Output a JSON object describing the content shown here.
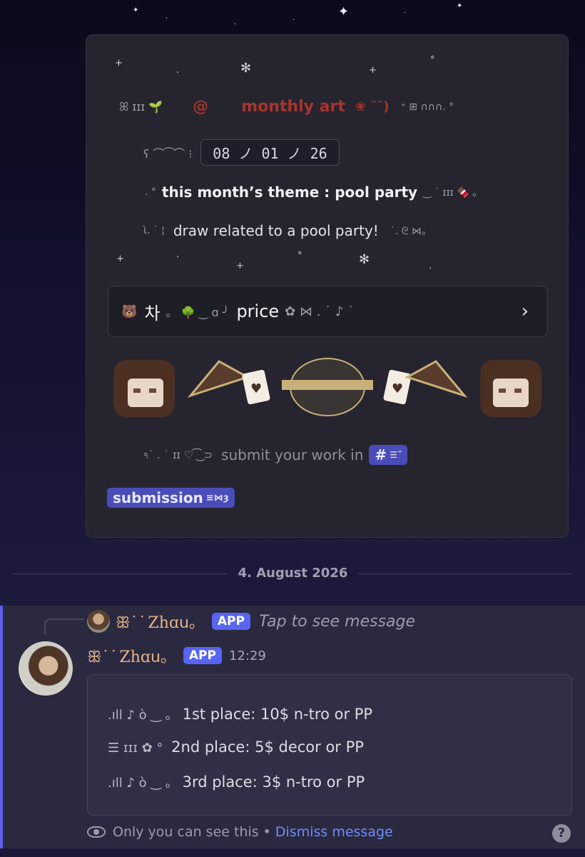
{
  "embed": {
    "title_prefix": "@",
    "title": "monthly art",
    "title_suffix": "❀ ˜˜)",
    "date": "08 ノ 01 ノ 26",
    "theme": "this month’s theme : pool party",
    "description": "draw related to a pool party!",
    "price_label": "price",
    "price_prefix": "차",
    "submit_text": "submit your work in",
    "channel_icon": "#",
    "channel_name": "submission"
  },
  "divider": {
    "date": "4. August 2026"
  },
  "message": {
    "reply": {
      "username": "ꕥ˙ ͘ Zhɑ𝗎。",
      "badge": "APP",
      "text": "Tap to see message"
    },
    "username": "ꕥ˙ ͘ Zhɑ𝗎。",
    "badge": "APP",
    "time": "12:29",
    "places": [
      "1st place: 10$ n-tro or PP",
      "2nd place: 5$ decor or PP",
      "3rd place: 3$ n-tro or PP"
    ],
    "footer_text": "Only you can see this",
    "footer_sep": "•",
    "dismiss_label": "Dismiss message",
    "help_label": "?"
  },
  "colors": {
    "accent": "#5865f2",
    "link": "#6f8cff",
    "title_red": "#a8342c"
  }
}
